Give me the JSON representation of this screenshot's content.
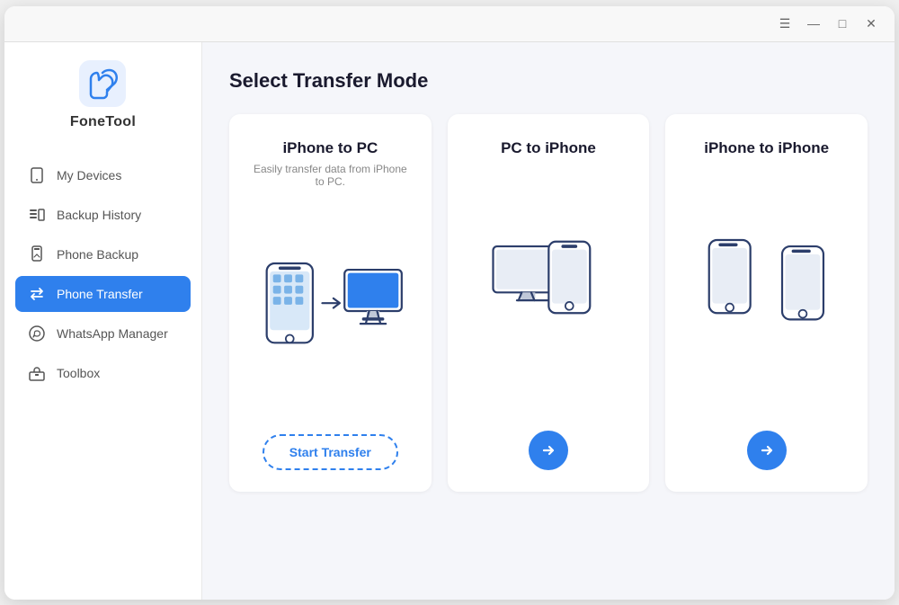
{
  "window": {
    "title": "FoneTool"
  },
  "titlebar": {
    "menu_icon": "☰",
    "minimize_icon": "—",
    "maximize_icon": "□",
    "close_icon": "✕"
  },
  "logo": {
    "text": "FoneTool"
  },
  "nav": {
    "items": [
      {
        "id": "my-devices",
        "label": "My Devices",
        "icon": "device"
      },
      {
        "id": "backup-history",
        "label": "Backup History",
        "icon": "backup-list"
      },
      {
        "id": "phone-backup",
        "label": "Phone Backup",
        "icon": "phone-backup"
      },
      {
        "id": "phone-transfer",
        "label": "Phone Transfer",
        "icon": "transfer",
        "active": true
      },
      {
        "id": "whatsapp-manager",
        "label": "WhatsApp Manager",
        "icon": "whatsapp"
      },
      {
        "id": "toolbox",
        "label": "Toolbox",
        "icon": "toolbox"
      }
    ]
  },
  "main": {
    "page_title": "Select Transfer Mode",
    "cards": [
      {
        "id": "iphone-to-pc",
        "title": "iPhone to PC",
        "subtitle": "Easily transfer data from iPhone to PC.",
        "action_label": "Start Transfer",
        "action_type": "start"
      },
      {
        "id": "pc-to-iphone",
        "title": "PC to iPhone",
        "subtitle": "",
        "action_label": "→",
        "action_type": "arrow"
      },
      {
        "id": "iphone-to-iphone",
        "title": "iPhone to iPhone",
        "subtitle": "",
        "action_label": "→",
        "action_type": "arrow"
      }
    ]
  }
}
